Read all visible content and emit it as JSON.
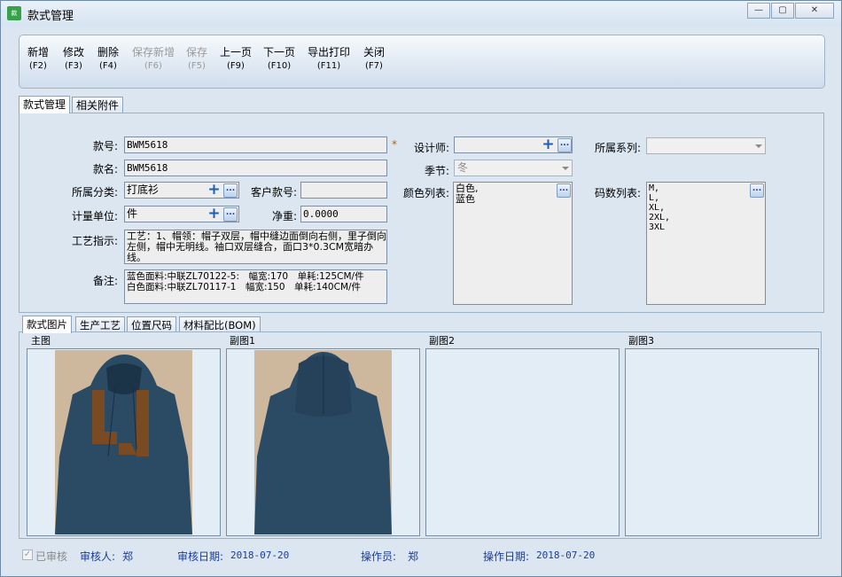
{
  "window": {
    "title": "款式管理",
    "app_icon": "app-logo-icon",
    "controls": {
      "minimize": "—",
      "maximize": "▢",
      "close": "✕"
    }
  },
  "toolbar": [
    {
      "label": "新增",
      "key": "(F2)",
      "enabled": true
    },
    {
      "label": "修改",
      "key": "(F3)",
      "enabled": true
    },
    {
      "label": "删除",
      "key": "(F4)",
      "enabled": true
    },
    {
      "label": "保存新增",
      "key": "(F6)",
      "enabled": false
    },
    {
      "label": "保存",
      "key": "(F5)",
      "enabled": false
    },
    {
      "label": "上一页",
      "key": "(F9)",
      "enabled": true
    },
    {
      "label": "下一页",
      "key": "(F10)",
      "enabled": true
    },
    {
      "label": "导出打印",
      "key": "(F11)",
      "enabled": true
    },
    {
      "label": "关闭",
      "key": "(F7)",
      "enabled": true
    }
  ],
  "tabs": {
    "main": "款式管理",
    "attachments": "相关附件"
  },
  "form": {
    "style_no": {
      "label": "款号:",
      "value": "BWM5618",
      "required": "*"
    },
    "style_name": {
      "label": "款名:",
      "value": "BWM5618"
    },
    "category": {
      "label": "所属分类:",
      "value": "打底衫"
    },
    "customer_no": {
      "label": "客户款号:",
      "value": ""
    },
    "unit": {
      "label": "计量单位:",
      "value": "件"
    },
    "net_weight": {
      "label": "净重:",
      "value": "0.0000"
    },
    "process": {
      "label": "工艺指示:",
      "value": "工艺：1、帽领：帽子双层，帽中缝边面倒向右侧，里子倒向左侧，帽中无明线。袖口双层缝合，面口3*0.3CM宽暗办线。"
    },
    "remark": {
      "label": "备注:",
      "line1": "蓝色面料:中联ZL70122-5:　幅宽:170　单耗:125CM/件",
      "line2": "白色面料:中联ZL70117-1　幅宽:150　单耗:140CM/件"
    },
    "designer": {
      "label": "设计师:",
      "value": ""
    },
    "season": {
      "label": "季节:",
      "value": "冬"
    },
    "colors": {
      "label": "颜色列表:",
      "items": [
        "白色,",
        "蓝色"
      ]
    },
    "series": {
      "label": "所属系列:",
      "value": ""
    },
    "sizes": {
      "label": "码数列表:",
      "items": [
        "M,",
        "L,",
        "XL,",
        "2XL,",
        "3XL"
      ]
    }
  },
  "subtabs": [
    "款式图片",
    "生产工艺",
    "位置尺码",
    "材料配比(BOM)"
  ],
  "images": [
    {
      "header": "主图",
      "has_photo": true,
      "view": "front"
    },
    {
      "header": "副图1",
      "has_photo": true,
      "view": "back"
    },
    {
      "header": "副图2",
      "has_photo": false
    },
    {
      "header": "副图3",
      "has_photo": false
    }
  ],
  "photo_colors": {
    "garment": "#2b4a64",
    "letter": "#7a4a22",
    "background": "#cdb89e"
  },
  "status": {
    "approved_label": "已审核",
    "reviewer_label": "审核人:",
    "reviewer": "郑",
    "review_date_label": "审核日期:",
    "review_date": "2018-07-20",
    "operator_label": "操作员:",
    "operator": "郑",
    "op_date_label": "操作日期:",
    "op_date": "2018-07-20"
  }
}
